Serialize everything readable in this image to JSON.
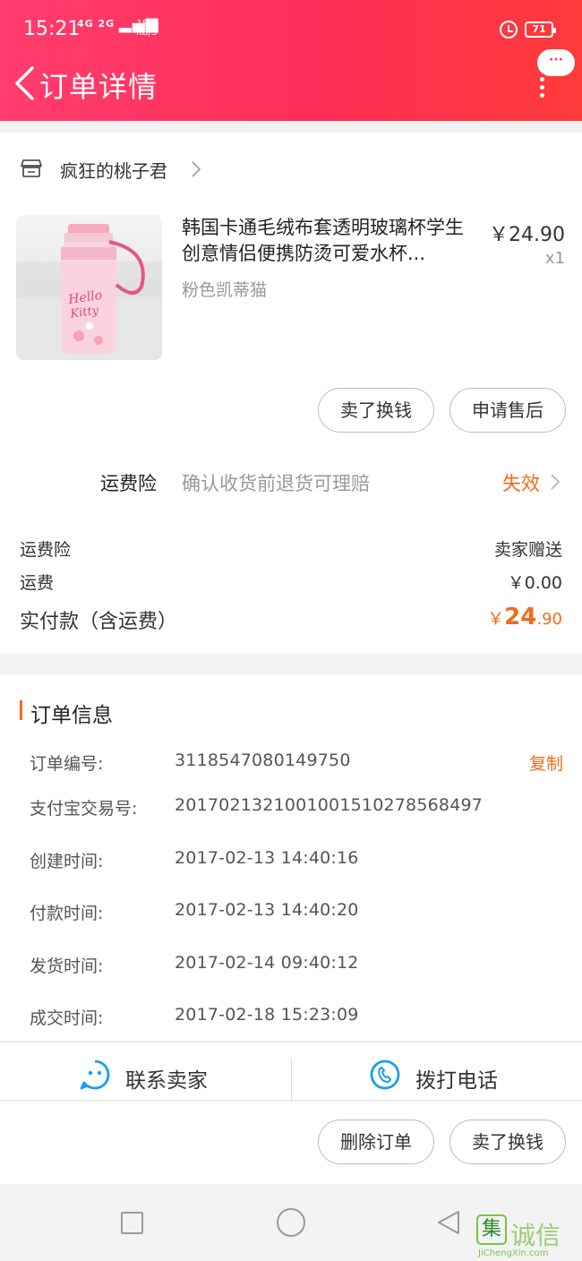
{
  "status_bar": {
    "time": "15:21",
    "network_top": "4G 2G",
    "speed_value": "18.0",
    "speed_unit": "KB/S",
    "battery": "71"
  },
  "navbar": {
    "title": "订单详情",
    "more_label": "···"
  },
  "shop": {
    "name": "疯狂的桃子君"
  },
  "product": {
    "title": "韩国卡通毛绒布套透明玻璃杯学生创意情侣便携防烫可爱水杯...",
    "sku": "粉色凯蒂猫",
    "price": "￥24.90",
    "quantity": "x1",
    "image_text": "Hello Kitty"
  },
  "product_actions": {
    "sell": "卖了换钱",
    "after_sale": "申请售后"
  },
  "insurance": {
    "label": "运费险",
    "description": "确认收货前退货可理赔",
    "status": "失效"
  },
  "fees": [
    {
      "label": "运费险",
      "value": "卖家赠送"
    },
    {
      "label": "运费",
      "value": "￥0.00"
    }
  ],
  "total": {
    "label": "实付款（含运费）",
    "currency": "￥",
    "integer": "24",
    "decimal": ".90"
  },
  "order_info": {
    "heading": "订单信息",
    "copy_label": "复制",
    "rows": [
      {
        "label": "订单编号:",
        "value": "3118547080149750"
      },
      {
        "label": "支付宝交易号:",
        "value": "2017021321001001510278568497"
      },
      {
        "label": "创建时间:",
        "value": "2017-02-13 14:40:16"
      },
      {
        "label": "付款时间:",
        "value": "2017-02-13 14:40:20"
      },
      {
        "label": "发货时间:",
        "value": "2017-02-14 09:40:12"
      },
      {
        "label": "成交时间:",
        "value": "2017-02-18 15:23:09"
      }
    ]
  },
  "contact": {
    "seller": "联系卖家",
    "call": "拨打电话"
  },
  "bottom_actions": {
    "delete": "删除订单",
    "sell": "卖了换钱"
  },
  "watermark": {
    "cn": "诚信",
    "en": "JiChengXin.com",
    "box_char": "集"
  },
  "colors": {
    "header_gradient_start": "#ff3d6e",
    "header_gradient_end": "#ff3a3a",
    "accent_orange": "#f26b1d",
    "icon_blue": "#1aa0e8"
  }
}
